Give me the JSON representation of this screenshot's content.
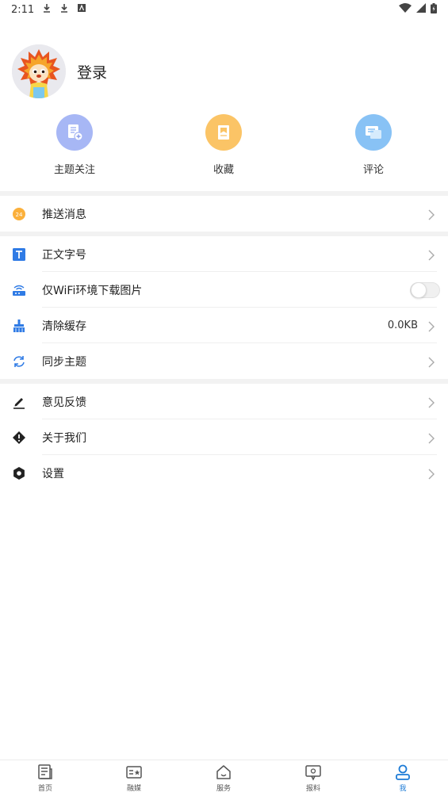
{
  "status_bar": {
    "time": "2:11"
  },
  "profile": {
    "login_label": "登录"
  },
  "quick_actions": [
    {
      "label": "主题关注",
      "icon": "document-add-icon",
      "color": "#a7b7f5"
    },
    {
      "label": "收藏",
      "icon": "bookmark-icon",
      "color": "#fbc466"
    },
    {
      "label": "评论",
      "icon": "comment-icon",
      "color": "#88c2f5"
    }
  ],
  "settings": {
    "push_messages": "推送消息",
    "font_size": "正文字号",
    "wifi_images": "仅WiFi环境下载图片",
    "wifi_images_enabled": false,
    "clear_cache": "清除缓存",
    "cache_size": "0.0KB",
    "sync_theme": "同步主题",
    "feedback": "意见反馈",
    "about_us": "关于我们",
    "settings": "设置"
  },
  "bottom_nav": [
    {
      "label": "首页",
      "icon": "newspaper-icon"
    },
    {
      "label": "融媒",
      "icon": "media-card-icon"
    },
    {
      "label": "服务",
      "icon": "home-icon"
    },
    {
      "label": "报料",
      "icon": "report-chat-icon"
    },
    {
      "label": "我",
      "icon": "person-icon",
      "active": true
    }
  ],
  "colors": {
    "accent": "#1d7bd6",
    "separator": "#f2f2f2"
  }
}
